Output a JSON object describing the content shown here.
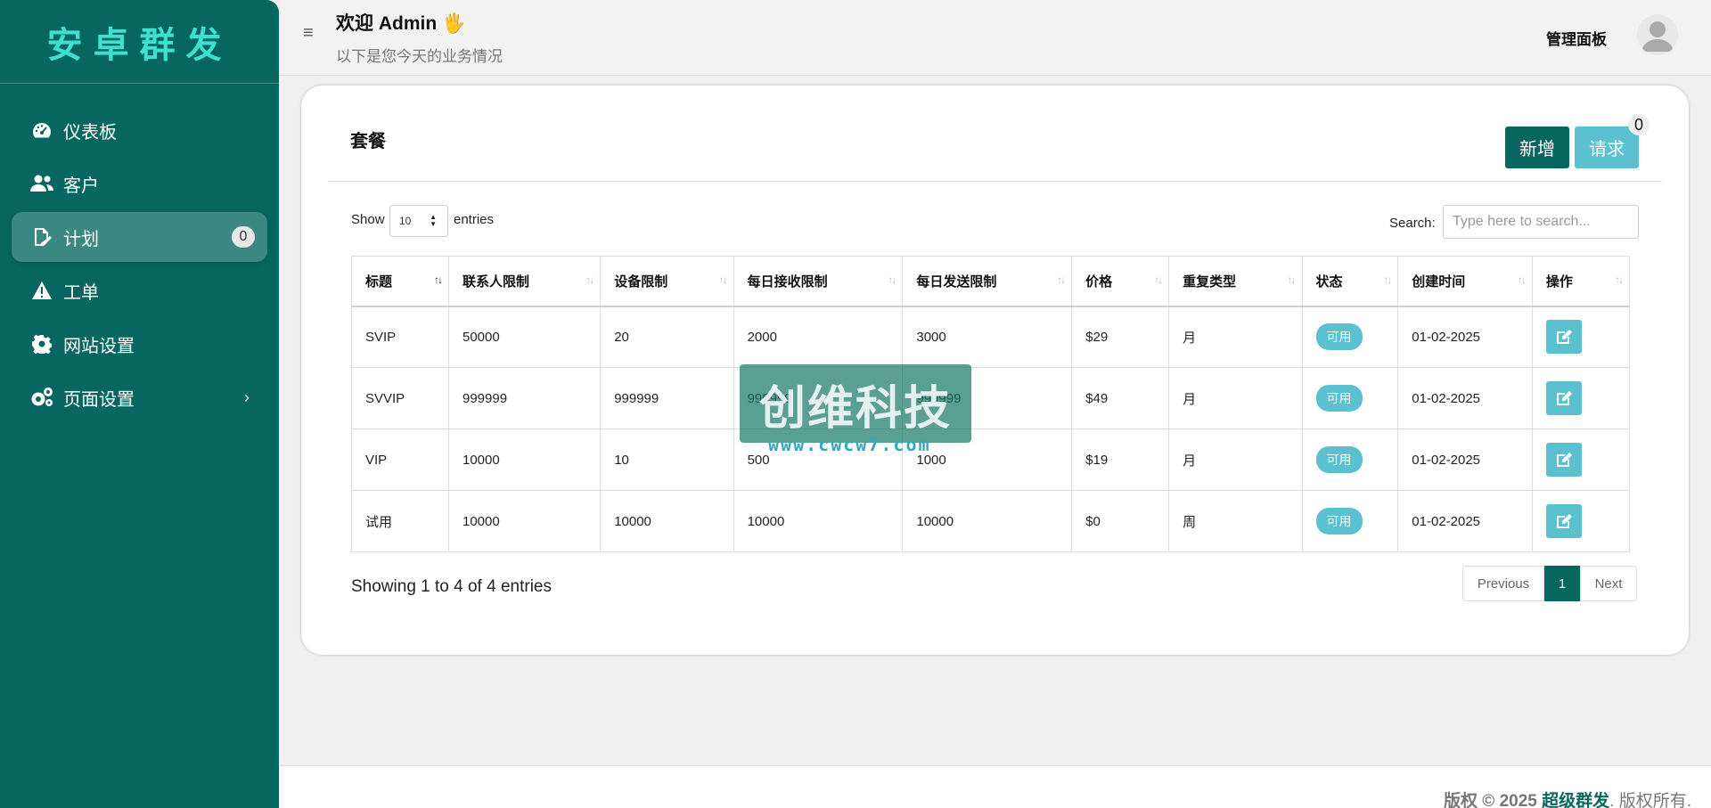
{
  "sidebar": {
    "brand": "安卓群发",
    "items": [
      {
        "label": "仪表板",
        "icon": "dashboard-icon"
      },
      {
        "label": "客户",
        "icon": "users-icon"
      },
      {
        "label": "计划",
        "icon": "edit-icon",
        "badge": "0"
      },
      {
        "label": "工单",
        "icon": "warning-icon"
      },
      {
        "label": "网站设置",
        "icon": "gear-icon"
      },
      {
        "label": "页面设置",
        "icon": "gears-icon"
      }
    ]
  },
  "header": {
    "welcome": "欢迎 Admin 🖐",
    "subtitle": "以下是您今天的业务情况",
    "panel": "管理面板"
  },
  "card": {
    "title": "套餐",
    "add_label": "新增",
    "request_label": "请求",
    "request_badge": "0",
    "show_label": "Show",
    "page_length": "10",
    "entries_label": "entries",
    "search_label": "Search:",
    "search_placeholder": "Type here to search...",
    "info": "Showing 1 to 4 of 4 entries",
    "pager": {
      "previous": "Previous",
      "current": "1",
      "next": "Next"
    }
  },
  "table": {
    "headers": [
      "标题",
      "联系人限制",
      "设备限制",
      "每日接收限制",
      "每日发送限制",
      "价格",
      "重复类型",
      "状态",
      "创建时间",
      "操作"
    ],
    "rows": [
      [
        "SVIP",
        "50000",
        "20",
        "2000",
        "3000",
        "$29",
        "月",
        "可用",
        "01-02-2025"
      ],
      [
        "SVVIP",
        "999999",
        "999999",
        "999999",
        "999999",
        "$49",
        "月",
        "可用",
        "01-02-2025"
      ],
      [
        "VIP",
        "10000",
        "10",
        "500",
        "1000",
        "$19",
        "月",
        "可用",
        "01-02-2025"
      ],
      [
        "试用",
        "10000",
        "10000",
        "10000",
        "10000",
        "$0",
        "周",
        "可用",
        "01-02-2025"
      ]
    ]
  },
  "watermark": {
    "text": "创维科技",
    "url": "www.cwcw7.com"
  },
  "footer": {
    "prefix": "版权 © 2025 ",
    "brand": "超级群发",
    "suffix": ". 版权所有."
  },
  "colors": {
    "primary": "#07665f",
    "accent": "#5bc0d0",
    "brand_text": "#3fe0d0"
  }
}
